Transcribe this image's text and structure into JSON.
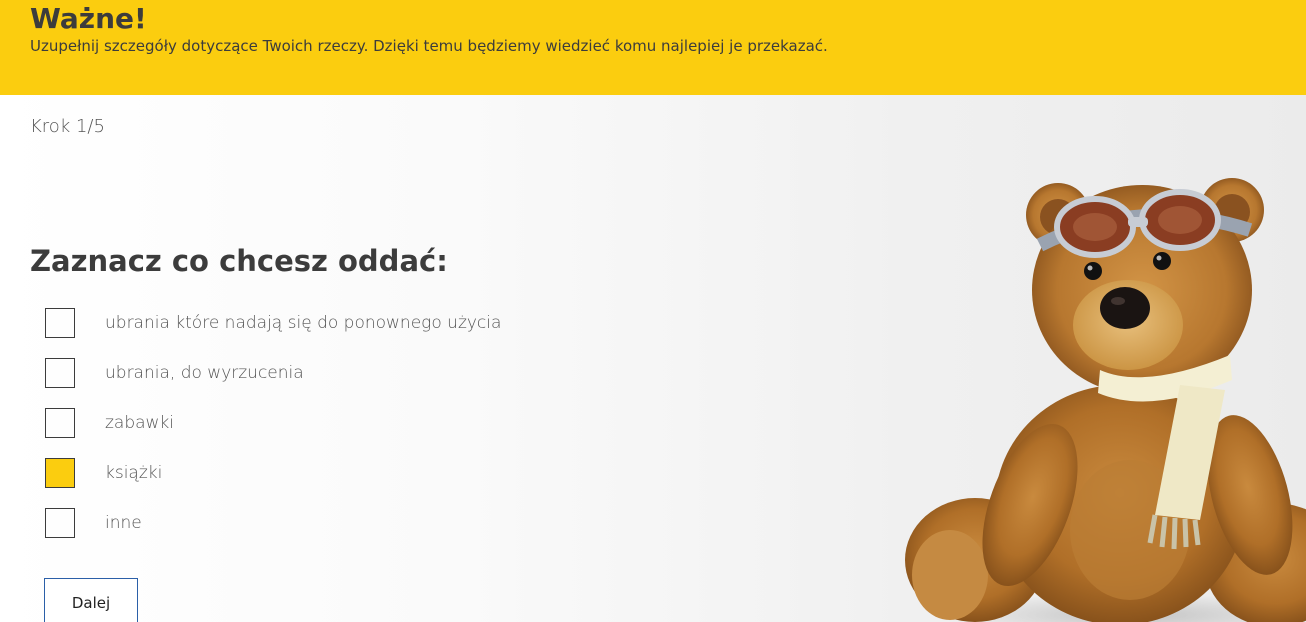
{
  "banner": {
    "title": "Ważne!",
    "text": "Uzupełnij szczegóły dotyczące Twoich rzeczy. Dzięki temu będziemy wiedzieć komu najlepiej je przekazać."
  },
  "form": {
    "step": "Krok 1/5",
    "heading": "Zaznacz co chcesz oddać:",
    "options": [
      {
        "label": "ubrania które nadają się do ponownego użycia",
        "checked": false
      },
      {
        "label": "ubrania, do wyrzucenia",
        "checked": false
      },
      {
        "label": "zabawki",
        "checked": false
      },
      {
        "label": "książki",
        "checked": true
      },
      {
        "label": "inne",
        "checked": false
      }
    ],
    "next_label": "Dalej"
  },
  "colors": {
    "accent": "#fbcd0f",
    "button_border": "#2b5fa8",
    "text": "#3c3c3c"
  }
}
